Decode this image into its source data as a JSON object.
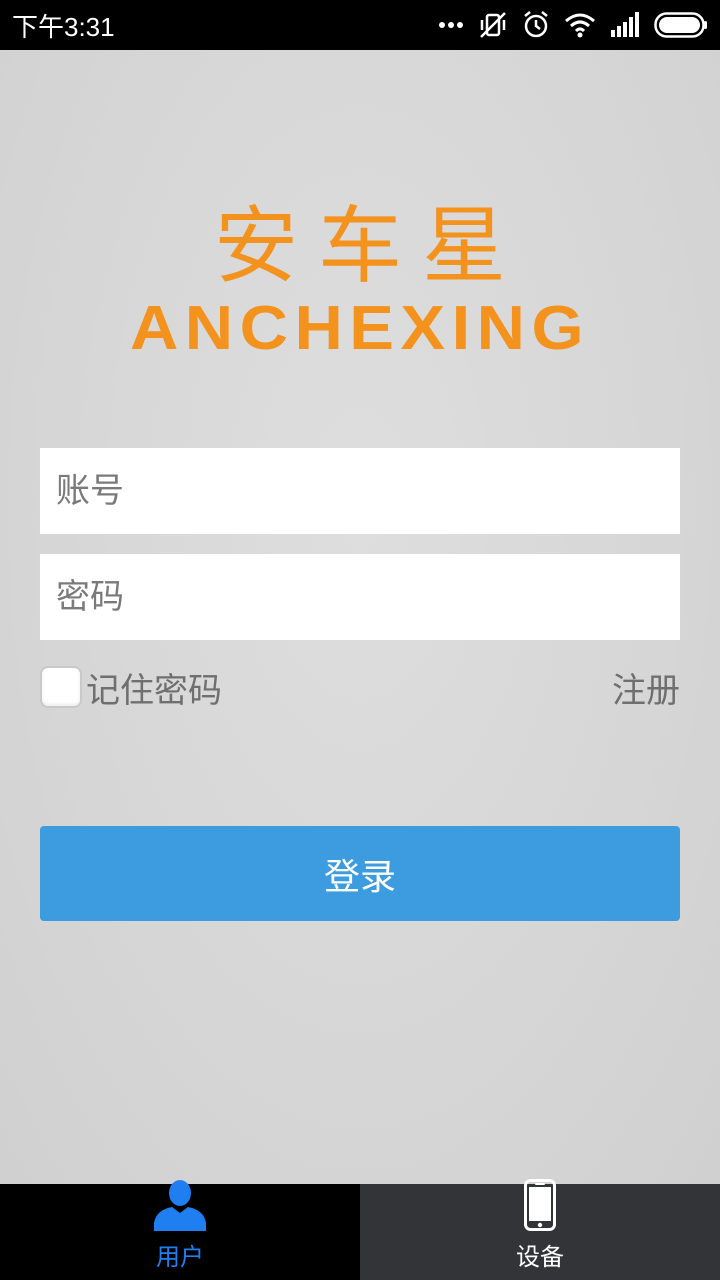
{
  "status_bar": {
    "time": "下午3:31",
    "icons": [
      "more-dots-icon",
      "vibrate-off-icon",
      "alarm-icon",
      "wifi-icon",
      "signal-icon",
      "battery-icon"
    ]
  },
  "logo": {
    "chinese": "安车星",
    "english": "ANCHEXING"
  },
  "login_form": {
    "account_placeholder": "账号",
    "password_placeholder": "密码",
    "remember_label": "记住密码",
    "remember_checked": false,
    "register_label": "注册",
    "login_button_label": "登录"
  },
  "tabs": [
    {
      "label": "用户",
      "icon": "user-icon",
      "active": true
    },
    {
      "label": "设备",
      "icon": "phone-device-icon",
      "active": false
    }
  ],
  "colors": {
    "brand_orange": "#f4921e",
    "button_blue": "#3d9be0",
    "active_tab_blue": "#1f7ef0"
  }
}
